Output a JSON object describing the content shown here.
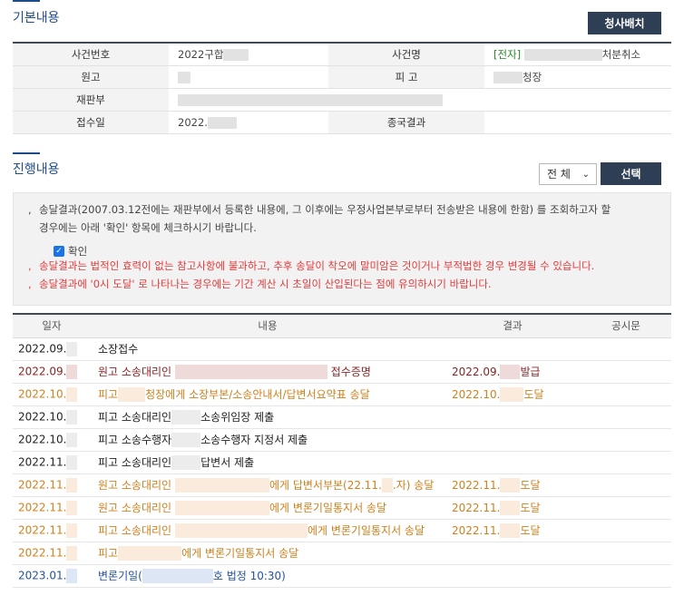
{
  "basic": {
    "title": "기본내용",
    "delivery_button": "청사배치",
    "labels": {
      "case_no": "사건번호",
      "case_name": "사건명",
      "plaintiff": "원고",
      "defendant": "피 고",
      "court": "재판부",
      "received": "접수일",
      "final_result": "종국결과"
    },
    "values": {
      "case_no": "2022구합",
      "case_name_tag": "[전자]",
      "case_name_suffix": "처분취소",
      "defendant_suffix": "청장",
      "received": "2022."
    }
  },
  "progress": {
    "title": "진행내용",
    "filter_value": "전 체",
    "select_button": "선택",
    "notice": {
      "line1": "송달결과(2007.03.12전에는 재판부에서 등록한 내용에, 그 이후에는 우정사업본부로부터 전송받은 내용에 한함) 를 조회하고자 할",
      "line1b": "경우에는 아래 '확인' 항목에 체크하시기 바랍니다.",
      "check_label": "확인",
      "line2": "송달결과는 법적인 효력이 없는 참고사항에 불과하고, 추후 송달이 착오에 말미암은 것이거나 부적법한 경우 변경될 수 있습니다.",
      "line3": "송달결과에 '0시 도달' 로 나타나는 경우에는 기간 계산 시 초일이 산입된다는 점에 유의하시기 바랍니다."
    },
    "columns": [
      "일자",
      "내용",
      "결과",
      "공시문"
    ],
    "rows": [
      {
        "color": "black",
        "date": "2022.09.",
        "c1": "소장접수",
        "c2": "",
        "result": "",
        "result2": ""
      },
      {
        "color": "brown",
        "date": "2022.09.",
        "c1": "원고 소송대리인",
        "c2": "접수증명",
        "result": "2022.09.",
        "result2": "발급"
      },
      {
        "color": "orange",
        "date": "2022.10.",
        "c1": "피고",
        "c2": "청장에게 소장부본/소송안내서/답변서요약표 송달",
        "result": "2022.10.",
        "result2": "도달"
      },
      {
        "color": "black",
        "date": "2022.10.",
        "c1": "피고 소송대리인",
        "c2": "소송위임장 제출",
        "result": "",
        "result2": ""
      },
      {
        "color": "black",
        "date": "2022.10.",
        "c1": "피고 소송수행자",
        "c2": "소송수행자 지정서 제출",
        "result": "",
        "result2": ""
      },
      {
        "color": "black",
        "date": "2022.11.",
        "c1": "피고 소송대리인",
        "c2": "답변서 제출",
        "result": "",
        "result2": ""
      },
      {
        "color": "orange",
        "date": "2022.11.",
        "c1": "원고 소송대리인",
        "c2": "에게 답변서부본(22.11.",
        "c3": ".자) 송달",
        "result": "2022.11.",
        "result2": "도달"
      },
      {
        "color": "orange",
        "date": "2022.11.",
        "c1": "원고 소송대리인",
        "c2": "에게 변론기일통지서 송달",
        "result": "2022.11.",
        "result2": "도달"
      },
      {
        "color": "orange",
        "date": "2022.11.",
        "c1": "피고 소송대리인",
        "c2": "에게 변론기일통지서 송달",
        "result": "2022.11.",
        "result2": "도달"
      },
      {
        "color": "orange",
        "date": "2022.11.",
        "c1": "피고",
        "c2": "에게 변론기일통지서 송달",
        "result": "",
        "result2": ""
      },
      {
        "color": "blue",
        "date": "2023.01.",
        "c1": "변론기일(",
        "c2": "호 법정 10:30)",
        "result": "",
        "result2": ""
      }
    ]
  }
}
